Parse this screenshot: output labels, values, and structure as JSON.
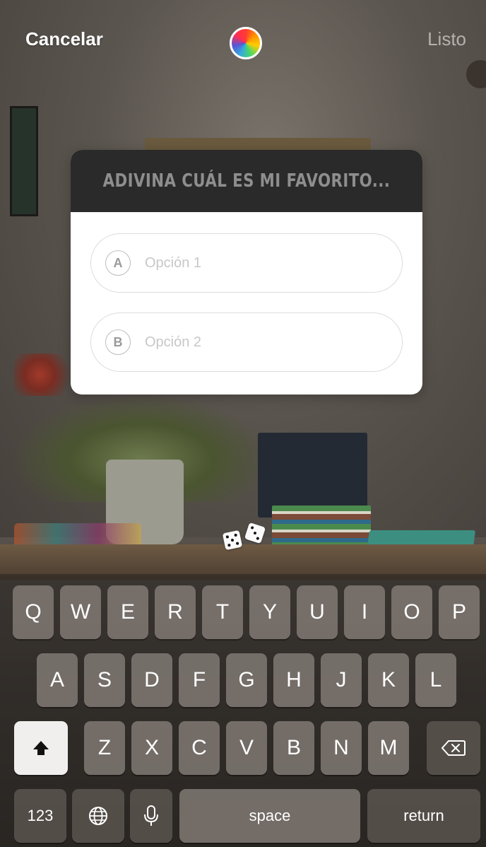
{
  "topbar": {
    "cancel_label": "Cancelar",
    "done_label": "Listo",
    "color_picker_icon": "color-wheel-icon"
  },
  "quiz": {
    "question": "ADIVINA CUÁL ES MI FAVORITO...",
    "options": [
      {
        "letter": "A",
        "placeholder": "Opción 1"
      },
      {
        "letter": "B",
        "placeholder": "Opción 2"
      }
    ]
  },
  "sticker": {
    "icon": "dice-icon"
  },
  "keyboard": {
    "row1": [
      "Q",
      "W",
      "E",
      "R",
      "T",
      "Y",
      "U",
      "I",
      "O",
      "P"
    ],
    "row2": [
      "A",
      "S",
      "D",
      "F",
      "G",
      "H",
      "J",
      "K",
      "L"
    ],
    "row3": [
      "Z",
      "X",
      "C",
      "V",
      "B",
      "N",
      "M"
    ],
    "shift_icon": "shift-icon",
    "backspace_icon": "backspace-icon",
    "numbers_label": "123",
    "globe_icon": "globe-icon",
    "mic_icon": "microphone-icon",
    "space_label": "space",
    "return_label": "return"
  },
  "colors": {
    "keyboard_key": "#807973",
    "shift_key": "#f0efed",
    "quiz_header": "#2a2a2a",
    "quiz_question_text": "#8e8e8e"
  }
}
